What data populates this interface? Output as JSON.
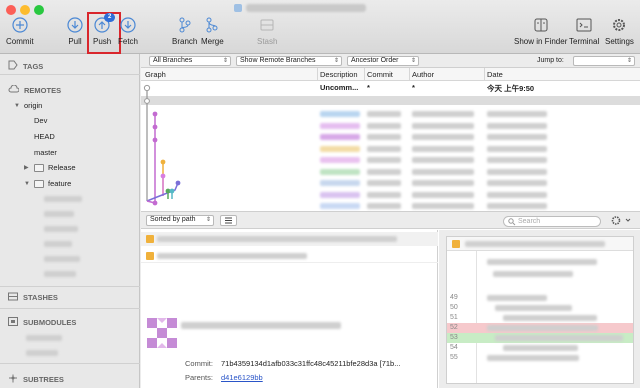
{
  "toolbar": {
    "commit": "Commit",
    "pull": "Pull",
    "push": "Push",
    "push_badge": "2",
    "fetch": "Fetch",
    "branch": "Branch",
    "merge": "Merge",
    "stash": "Stash",
    "show_in_finder": "Show in Finder",
    "terminal": "Terminal",
    "settings": "Settings"
  },
  "sidebar": {
    "tags": "TAGS",
    "remotes": "REMOTES",
    "origin": "origin",
    "branches": [
      "Dev",
      "HEAD",
      "master"
    ],
    "release": "Release",
    "feature": "feature",
    "stashes": "STASHES",
    "submodules": "SUBMODULES",
    "subtrees": "SUBTREES"
  },
  "filters": {
    "branches": "All Branches",
    "remote": "Show Remote Branches",
    "order": "Ancestor Order",
    "jump_to": "Jump to:"
  },
  "columns": {
    "graph": "Graph",
    "description": "Description",
    "commit": "Commit",
    "author": "Author",
    "date": "Date"
  },
  "uncommitted_row": {
    "description": "Uncomm...",
    "commit": "*",
    "author": "*",
    "date": "今天 上午9:50"
  },
  "midbar": {
    "sort": "Sorted by path",
    "search_placeholder": "Search"
  },
  "commit_info": {
    "commit_label": "Commit:",
    "commit_value": "71b4359134d1afb033c31ffc48c45211bfe28d3a [71b...",
    "parents_label": "Parents:",
    "parents_value": "d41e6129bb"
  },
  "diff_line_numbers": [
    "49",
    "50",
    "51",
    "52",
    "53",
    "54",
    "55"
  ],
  "colors": {
    "push_highlight": "#d9262c",
    "badge": "#2f6ed8",
    "diff_removed": "#f6c9cc",
    "diff_added": "#c8ecc5"
  }
}
